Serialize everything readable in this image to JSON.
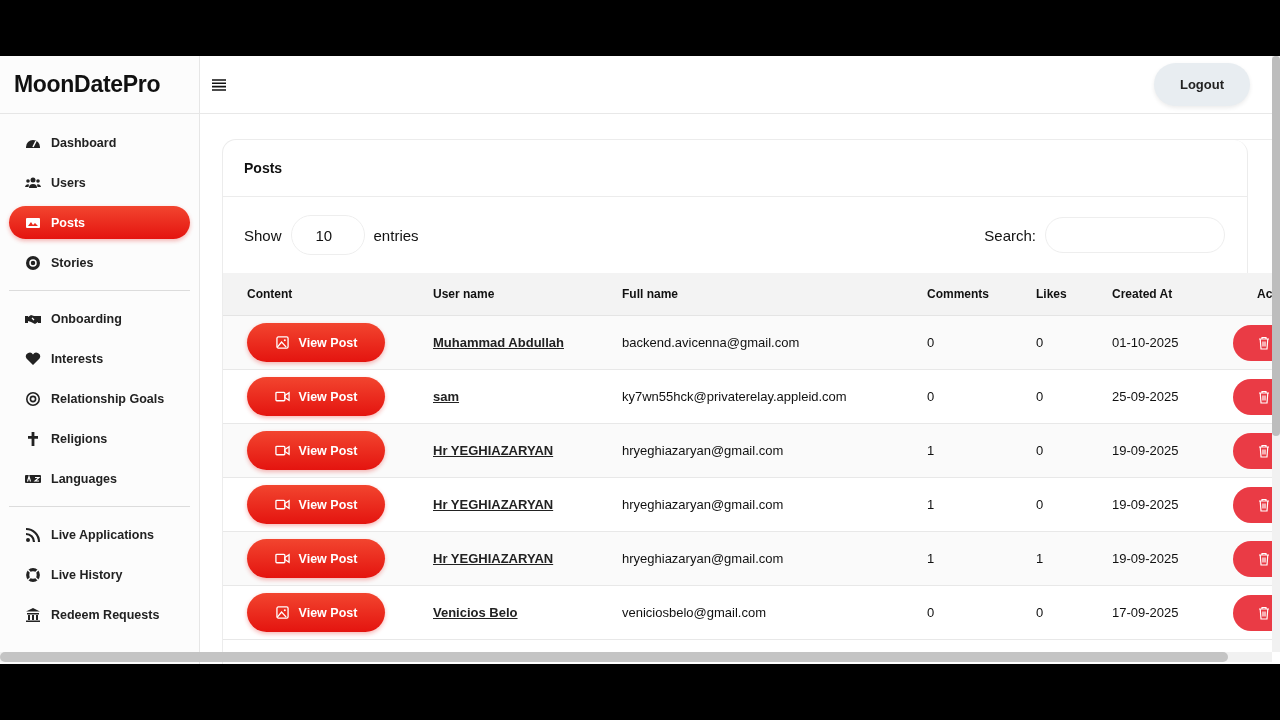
{
  "logo": "MoonDatePro",
  "header": {
    "logout": "Logout"
  },
  "sidebar": {
    "groups": [
      [
        {
          "label": "Dashboard",
          "selected": false
        },
        {
          "label": "Users",
          "selected": false
        },
        {
          "label": "Posts",
          "selected": true
        },
        {
          "label": "Stories",
          "selected": false
        }
      ],
      [
        {
          "label": "Onboarding",
          "selected": false
        },
        {
          "label": "Interests",
          "selected": false
        },
        {
          "label": "Relationship Goals",
          "selected": false
        },
        {
          "label": "Religions",
          "selected": false
        },
        {
          "label": "Languages",
          "selected": false
        }
      ],
      [
        {
          "label": "Live Applications",
          "selected": false
        },
        {
          "label": "Live History",
          "selected": false
        },
        {
          "label": "Redeem Requests",
          "selected": false
        }
      ]
    ]
  },
  "card": {
    "title": "Posts",
    "show_label": "Show",
    "entries_value": "10",
    "entries_label": "entries",
    "search_label": "Search:"
  },
  "table": {
    "columns": [
      "Content",
      "User name",
      "Full name",
      "Comments",
      "Likes",
      "Created At",
      "Ac"
    ],
    "rows": [
      {
        "kind": "image",
        "button": "View Post",
        "user": "Muhammad Abdullah",
        "full_name": "backend.avicenna@gmail.com",
        "comments": "0",
        "likes": "0",
        "created": "01-10-2025"
      },
      {
        "kind": "video",
        "button": "View Post",
        "user": "sam",
        "full_name": "ky7wn55hck@privaterelay.appleid.com",
        "comments": "0",
        "likes": "0",
        "created": "25-09-2025"
      },
      {
        "kind": "video",
        "button": "View Post",
        "user": "Hr YEGHIAZARYAN",
        "full_name": "hryeghiazaryan@gmail.com",
        "comments": "1",
        "likes": "0",
        "created": "19-09-2025"
      },
      {
        "kind": "video",
        "button": "View Post",
        "user": "Hr YEGHIAZARYAN",
        "full_name": "hryeghiazaryan@gmail.com",
        "comments": "1",
        "likes": "0",
        "created": "19-09-2025"
      },
      {
        "kind": "video",
        "button": "View Post",
        "user": "Hr YEGHIAZARYAN",
        "full_name": "hryeghiazaryan@gmail.com",
        "comments": "1",
        "likes": "1",
        "created": "19-09-2025"
      },
      {
        "kind": "image",
        "button": "View Post",
        "user": "Venicios Belo",
        "full_name": "veniciosbelo@gmail.com",
        "comments": "0",
        "likes": "0",
        "created": "17-09-2025"
      }
    ]
  }
}
